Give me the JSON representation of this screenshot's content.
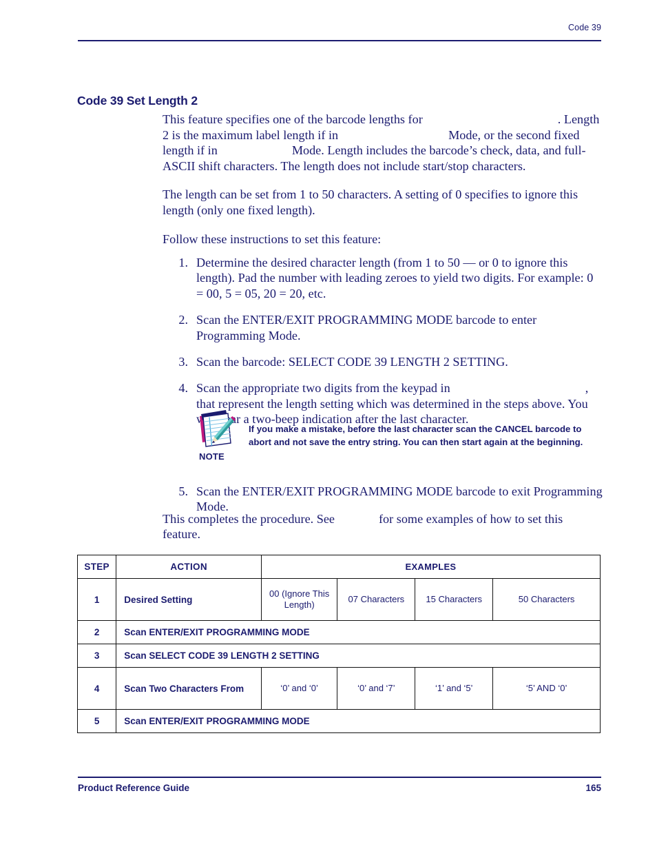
{
  "header": {
    "running_head": "Code 39"
  },
  "section": {
    "title": "Code 39 Set Length 2"
  },
  "intro": {
    "p1_a": "This feature specifies one of the barcode lengths for",
    "p1_b": ". Length 2 is the maximum label length if in",
    "p1_c": "Mode, or the second fixed length if in",
    "p1_d": "Mode. Length includes the barcode’s check, data, and full-ASCII shift characters.  The length does not include start/stop characters.",
    "p2": "The length can be set from 1 to 50 characters. A setting of 0 specifies to ignore this length (only one fixed length).",
    "p3": "Follow these instructions to set this feature:"
  },
  "steps": [
    {
      "num": "1.",
      "text": "Determine the desired character length (from 1 to 50 — or 0 to ignore this length). Pad the number with leading zeroes to yield two digits. For example: 0 = 00, 5 = 05, 20 = 20, etc."
    },
    {
      "num": "2.",
      "text": "Scan the ENTER/EXIT PROGRAMMING MODE barcode to enter Programming Mode."
    },
    {
      "num": "3.",
      "text": "Scan the barcode: SELECT CODE 39 LENGTH 2 SETTING."
    },
    {
      "num": "4.",
      "text_a": "Scan the appropriate two digits from the keypad in",
      "text_b": ", that represent the length setting which was determined in the steps above. You will hear a two-beep indication after the last character."
    }
  ],
  "note": {
    "label": "NOTE",
    "icon": "notepad-pencil-icon",
    "text": "If you make a mistake, before the last character scan the CANCEL barcode to abort and not save the entry string. You can then start again at the beginning."
  },
  "step5": {
    "num": "5.",
    "text": "Scan the ENTER/EXIT PROGRAMMING MODE barcode to exit Programming Mode."
  },
  "closing": {
    "a": "This completes the procedure. See",
    "b": "for some examples of how to set this feature."
  },
  "table": {
    "headers": {
      "step": "STEP",
      "action": "ACTION",
      "examples": "EXAMPLES"
    },
    "rows": [
      {
        "step": "1",
        "action": "Desired Setting",
        "examples": [
          "00 (Ignore This Length)",
          "07 Characters",
          "15 Characters",
          "50 Characters"
        ]
      },
      {
        "step": "2",
        "action": "Scan ENTER/EXIT PROGRAMMING MODE",
        "examples": []
      },
      {
        "step": "3",
        "action": "Scan SELECT CODE 39 LENGTH 2 SETTING",
        "examples": []
      },
      {
        "step": "4",
        "action": "Scan Two Characters From",
        "examples": [
          "‘0’ and ‘0’",
          "‘0’ and ‘7’",
          "‘1’ and ‘5’",
          "‘5’ AND ‘0’"
        ]
      },
      {
        "step": "5",
        "action": "Scan ENTER/EXIT PROGRAMMING MODE",
        "examples": []
      }
    ]
  },
  "footer": {
    "left": "Product Reference Guide",
    "page": "165"
  },
  "colors": {
    "navy": "#1b1b6f",
    "rule": "#1b1b6f",
    "table_border": "#111111"
  }
}
